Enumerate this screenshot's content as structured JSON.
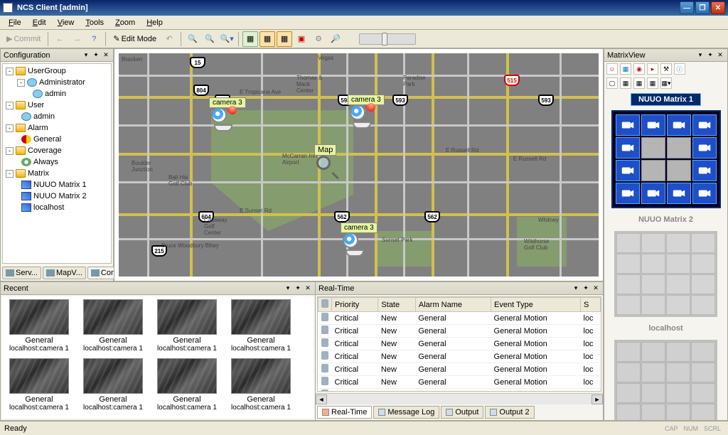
{
  "window": {
    "title": "NCS Client [admin]"
  },
  "menu": {
    "file": "File",
    "edit": "Edit",
    "view": "View",
    "tools": "Tools",
    "zoom": "Zoom",
    "help": "Help"
  },
  "toolbar": {
    "commit": "Commit",
    "editmode": "Edit Mode"
  },
  "config": {
    "title": "Configuration",
    "nodes": {
      "usergroup": "UserGroup",
      "administrator": "Administrator",
      "admin": "admin",
      "user": "User",
      "admin2": "admin",
      "alarm": "Alarm",
      "general": "General",
      "coverage": "Coverage",
      "always": "Always",
      "matrix": "Matrix",
      "m1": "NUUO Matrix 1",
      "m2": "NUUO Matrix 2",
      "localhost": "localhost"
    },
    "tabs": {
      "serv": "Serv...",
      "mapv": "MapV...",
      "confi": "Confi..."
    }
  },
  "map": {
    "cameras": {
      "c3top": "camera 3",
      "c3mid": "camera 3",
      "maplbl": "Map"
    },
    "shields": {
      "s15": "15",
      "s804": "804",
      "s593a": "593",
      "s593b": "593",
      "s593c": "593",
      "s593d": "593",
      "s604": "604",
      "s562a": "562",
      "s562b": "562",
      "s215": "215"
    },
    "labels": {
      "vegas": "Vegas",
      "bracken": "Bracken",
      "tropicana": "E Tropicana Ave",
      "russell": "E Russell Rd",
      "russell2": "E Russell Rd",
      "sunset": "E Sunset Rd",
      "mccarran": "McCarran Int'l Airport",
      "thomas": "Thomas & Mack Center",
      "paradise": "Paradise Park",
      "sunsetpk": "Sunset Park",
      "whitney": "Whitney",
      "wildhorse": "Wildhorse Golf Club",
      "callaway": "Callaway Golf Center",
      "boulder": "Boulder Junction",
      "balihai": "Bali Hai Golf Club",
      "woodbury": "Bruce Woodbury Bltwy"
    }
  },
  "matrixview": {
    "title": "MatrixView",
    "m1": "NUUO Matrix 1",
    "m2": "NUUO Matrix 2",
    "localhost": "localhost"
  },
  "recent": {
    "title": "Recent",
    "item": {
      "name": "General",
      "src": "localhost:camera 1"
    }
  },
  "realtime": {
    "title": "Real-Time",
    "cols": {
      "clip": "",
      "priority": "Priority",
      "state": "State",
      "alarm": "Alarm Name",
      "event": "Event Type",
      "s": "S"
    },
    "row": {
      "priority": "Critical",
      "state": "New",
      "alarm": "General",
      "event": "General Motion",
      "s": "loc"
    },
    "tabs": {
      "rt": "Real-Time",
      "msg": "Message Log",
      "out": "Output",
      "out2": "Output 2"
    }
  },
  "status": {
    "ready": "Ready",
    "cap": "CAP",
    "num": "NUM",
    "scrl": "SCRL"
  }
}
